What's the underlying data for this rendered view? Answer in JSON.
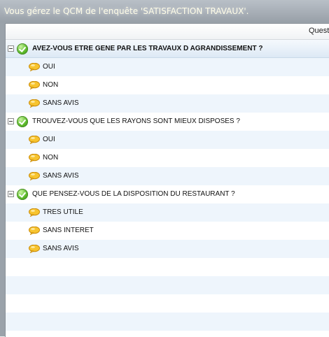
{
  "window": {
    "title": "Vous gérez le QCM de l'enquête 'SATISFACTION TRAVAUX'."
  },
  "grid": {
    "column_header": "Questions",
    "questions": [
      {
        "text": "AVEZ-VOUS ETRE GENE PAR LES TRAVAUX D AGRANDISSEMENT ?",
        "selected": true,
        "answers": [
          "OUI",
          "NON",
          "SANS AVIS"
        ]
      },
      {
        "text": "TROUVEZ-VOUS QUE LES RAYONS SONT MIEUX DISPOSES ?",
        "selected": false,
        "answers": [
          "OUI",
          "NON",
          "SANS AVIS"
        ]
      },
      {
        "text": "QUE PENSEZ-VOUS DE LA DISPOSITION DU RESTAURANT ?",
        "selected": false,
        "answers": [
          "TRES UTILE",
          "SANS INTERET",
          "SANS AVIS"
        ]
      }
    ]
  },
  "icons": {
    "question": "check-circle-icon",
    "answer": "speech-bubble-icon",
    "expander": "collapse-minus-icon"
  },
  "colors": {
    "row_band": "#eef5fc",
    "selected_row": "#dde9f5",
    "title_text": "#fffde8"
  }
}
